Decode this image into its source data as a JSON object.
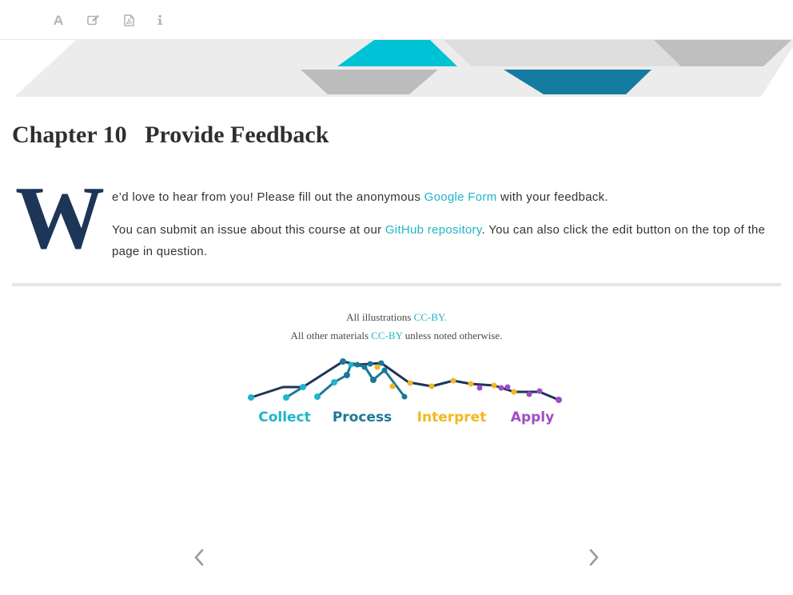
{
  "toolbar": {
    "buttons": [
      {
        "icon": "font-icon"
      },
      {
        "icon": "edit-icon"
      },
      {
        "icon": "pdf-icon"
      },
      {
        "icon": "info-icon"
      }
    ]
  },
  "colors": {
    "link": "#1fb5c9",
    "title": "#2f2f2f",
    "navy": "#1d3557",
    "teal": "#1b7896",
    "cyan": "#1fb5c9",
    "yellow": "#f2b81d",
    "purple": "#a24bc5",
    "icon_gray": "#b3b3b3"
  },
  "chapter": {
    "title": "Chapter 10   Provide Feedback",
    "drop_cap": "W"
  },
  "content": {
    "p1_text_1": "e’d love to hear from you! Please fill out the anonymous ",
    "p1_link": "Google Form",
    "p1_text_2": " with your feedback.",
    "p2_text_1": "You can submit an issue about this course at our ",
    "p2_link": "GitHub repository",
    "p2_text_2": ". You can also click the edit button on the top of the page in question."
  },
  "footer": {
    "line1_text": "All illustrations ",
    "line1_link": "CC-BY.",
    "line2_text_1": "All other materials ",
    "line2_link": "CC-BY",
    "line2_text_2": " unless noted otherwise."
  },
  "logo": {
    "labels": [
      "Collect",
      "Process",
      "Interpret",
      "Apply"
    ]
  },
  "navigation": {
    "prev_icon": "chevron-left-icon",
    "next_icon": "chevron-right-icon"
  }
}
